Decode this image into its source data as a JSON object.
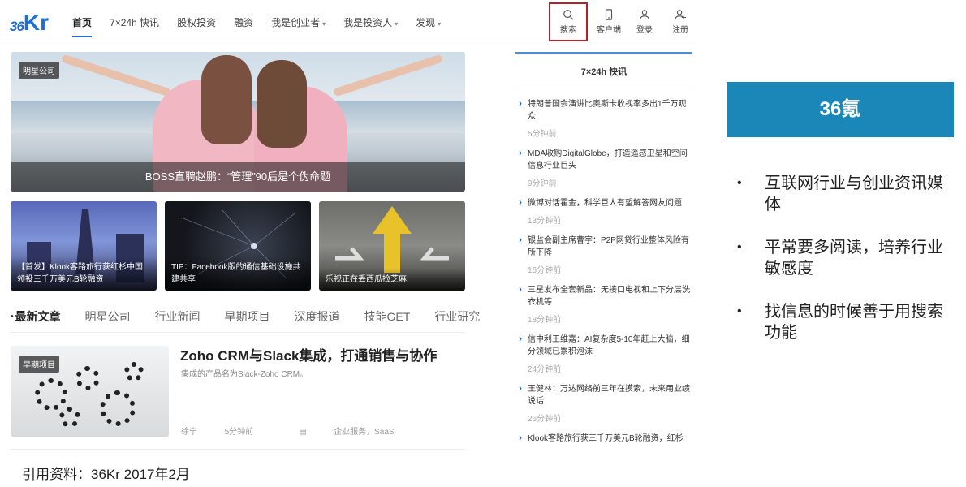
{
  "logo": {
    "num": "36",
    "kr": "Kr"
  },
  "nav": {
    "items": [
      {
        "label": "首页",
        "active": true
      },
      {
        "label": "7×24h 快讯"
      },
      {
        "label": "股权投资"
      },
      {
        "label": "融资"
      },
      {
        "label": "我是创业者",
        "caret": "▾"
      },
      {
        "label": "我是投资人",
        "caret": "▾"
      },
      {
        "label": "发现",
        "caret": "▾"
      }
    ],
    "tools": {
      "search": "搜索",
      "client": "客户端",
      "login": "登录",
      "register": "注册"
    }
  },
  "hero": {
    "tag": "明星公司",
    "caption": "BOSS直聘赵鹏：“管理”90后是个伪命题"
  },
  "thumbs": [
    {
      "caption": "【首发】Klook客路旅行获红杉中国领投三千万美元B轮融资"
    },
    {
      "caption": "TIP：Facebook版的通信基础设施共建共享"
    },
    {
      "caption": "乐视正在丢西瓜捡芝麻"
    }
  ],
  "categories": [
    "最新文章",
    "明星公司",
    "行业新闻",
    "早期项目",
    "深度报道",
    "技能GET",
    "行业研究"
  ],
  "article": {
    "tag": "早期项目",
    "title": "Zoho CRM与Slack集成，打通销售与协作",
    "desc": "集成的产品名为Slack-Zoho CRM。",
    "author": "徐宁",
    "time": "5分钟前",
    "category": "企业服务，SaaS"
  },
  "side": {
    "title": "7×24h 快讯",
    "news": [
      {
        "text": "特朗普国会演讲比奥斯卡收视率多出1千万观众",
        "time": "5分钟前"
      },
      {
        "text": "MDA收购DigitalGlobe，打造遥感卫星和空间信息行业巨头",
        "time": "9分钟前"
      },
      {
        "text": "微博对话霍金，科学巨人有望解答网友问题",
        "time": "13分钟前"
      },
      {
        "text": "银监会副主席曹宇：P2P网贷行业整体风险有所下降",
        "time": "16分钟前"
      },
      {
        "text": "三星发布全套新品：无接口电视和上下分层洗衣机等",
        "time": "18分钟前"
      },
      {
        "text": "信中利王维嘉：AI复杂度5-10年赶上大脑，细分领域已累积泡沫",
        "time": "24分钟前"
      },
      {
        "text": "王健林：万达网络前三年在摸索，未来用业绩说话",
        "time": "26分钟前"
      },
      {
        "text": "Klook客路旅行获三千万美元B轮融资，红杉",
        "time": ""
      }
    ]
  },
  "reference": "引用资料：36Kr 2017年2月",
  "slide": {
    "brand": "36氪",
    "bullets": [
      "互联网行业与创业资讯媒体",
      "平常要多阅读，培养行业敏感度",
      "找信息的时候善于用搜索功能"
    ]
  },
  "colors": {
    "accent": "#1f6fd1",
    "brand_box": "#1b87b8",
    "search_highlight": "#b0212a"
  }
}
